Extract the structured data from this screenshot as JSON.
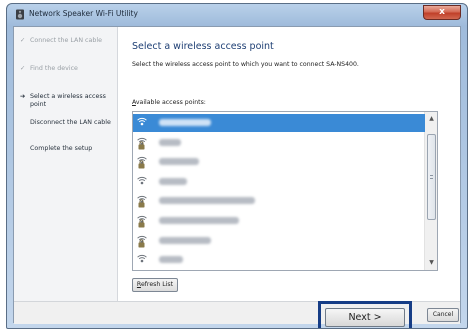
{
  "window": {
    "title": "Network Speaker Wi-Fi Utility",
    "close_label": "x"
  },
  "sidebar": {
    "steps": [
      {
        "label": "Connect the LAN cable",
        "state": "done",
        "mark": "✓"
      },
      {
        "label": "Find the device",
        "state": "done",
        "mark": "✓"
      },
      {
        "label": "Select a wireless access point",
        "state": "active",
        "mark": "➔"
      },
      {
        "label": "Disconnect the LAN cable",
        "state": "pending",
        "mark": ""
      },
      {
        "label": "Complete the setup",
        "state": "pending",
        "mark": ""
      }
    ]
  },
  "main": {
    "heading": "Select a wireless access point",
    "instruction": "Select the wireless access point to which you want to connect SA-NS400.",
    "list_label_accel": "A",
    "list_label_rest": "vailable access points:",
    "access_points": [
      {
        "icon": "wifi-signal-icon",
        "secured": false,
        "selected": true
      },
      {
        "icon": "wifi-signal-lock-icon",
        "secured": true,
        "selected": false
      },
      {
        "icon": "wifi-signal-lock-icon",
        "secured": true,
        "selected": false
      },
      {
        "icon": "wifi-signal-icon",
        "secured": false,
        "selected": false
      },
      {
        "icon": "wifi-signal-lock-icon",
        "secured": true,
        "selected": false
      },
      {
        "icon": "wifi-signal-lock-icon",
        "secured": true,
        "selected": false
      },
      {
        "icon": "wifi-signal-lock-icon",
        "secured": true,
        "selected": false
      },
      {
        "icon": "wifi-signal-icon",
        "secured": false,
        "selected": false
      }
    ],
    "refresh_accel": "R",
    "refresh_rest": "efresh List"
  },
  "footer": {
    "next_label": "Next >",
    "cancel_label": "Cancel"
  },
  "colors": {
    "selection": "#3a8ad6",
    "heading": "#1e3f74",
    "highlight_box": "#163d86"
  }
}
